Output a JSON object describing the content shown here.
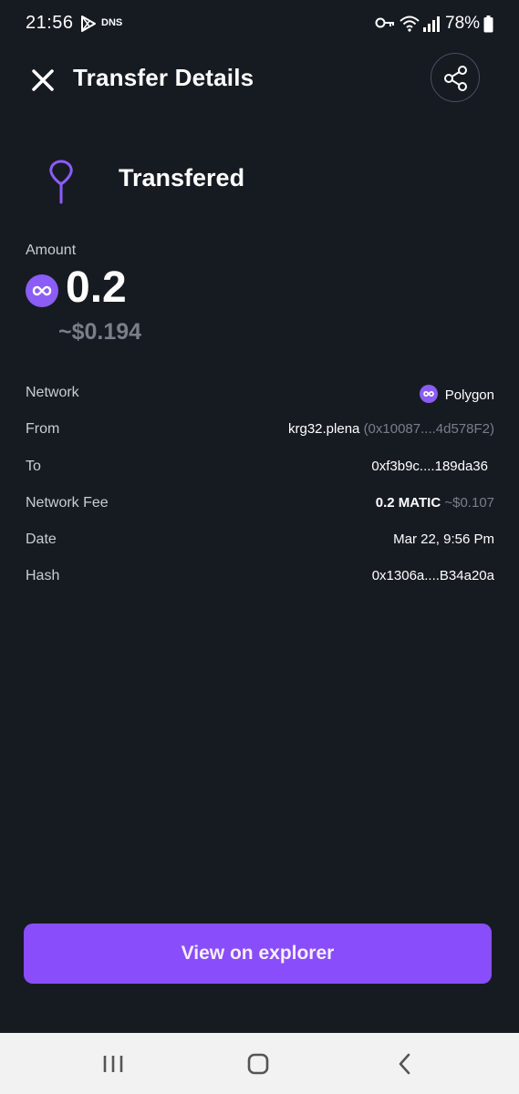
{
  "status_bar": {
    "time": "21:56",
    "dns_label": "DNS",
    "battery": "78%"
  },
  "header": {
    "title": "Transfer Details",
    "close_icon": "close-icon",
    "share_icon": "share-icon"
  },
  "transaction": {
    "status": "Transfered",
    "status_icon": "location-pin-icon"
  },
  "amount": {
    "label": "Amount",
    "value": "0.2",
    "usd": "~$0.194",
    "token_icon": "polygon-matic-icon"
  },
  "details": {
    "network": {
      "label": "Network",
      "value": "Polygon"
    },
    "from": {
      "label": "From",
      "name": "krg32.plena",
      "address": "(0x10087....4d578F2)"
    },
    "to": {
      "label": "To",
      "value": "0xf3b9c....189da36"
    },
    "network_fee": {
      "label": "Network Fee",
      "amount": "0.2 MATIC",
      "usd": "~$0.107"
    },
    "date": {
      "label": "Date",
      "value": "Mar 22, 9:56 Pm"
    },
    "hash": {
      "label": "Hash",
      "value": "0x1306a....B34a20a"
    }
  },
  "actions": {
    "view_explorer": "View on explorer"
  },
  "colors": {
    "background": "#161b22",
    "accent": "#8a4dfc",
    "muted_text": "#7a7f87"
  }
}
